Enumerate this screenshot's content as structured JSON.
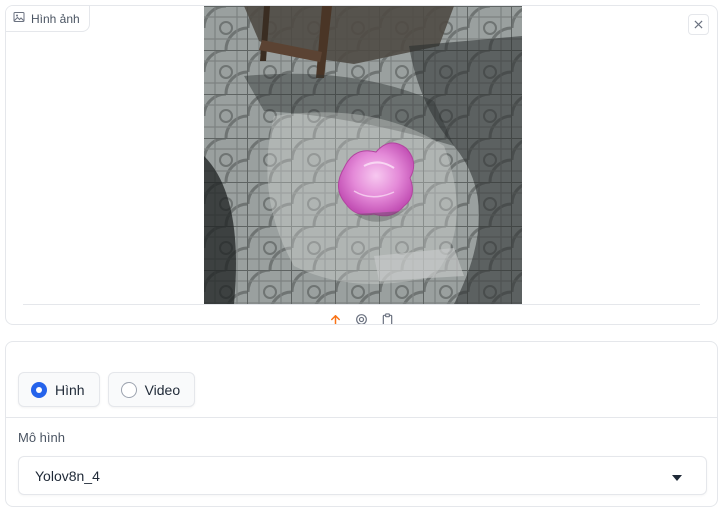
{
  "image_panel": {
    "label": "Hình ảnh",
    "label_icon": "image-icon",
    "close_icon": "close-icon",
    "toolbar_icons": [
      "upload-icon",
      "webcam-icon",
      "clipboard-icon"
    ]
  },
  "controls": {
    "input_type": {
      "options": [
        {
          "label": "Hình",
          "checked": true
        },
        {
          "label": "Video",
          "checked": false
        }
      ]
    },
    "model": {
      "label": "Mô hình",
      "selected": "Yolov8n_4",
      "dropdown_icon": "caret-down-icon"
    }
  },
  "colors": {
    "accent": "#2563eb",
    "upload_icon": "#f97316",
    "border": "#e5e7eb"
  }
}
